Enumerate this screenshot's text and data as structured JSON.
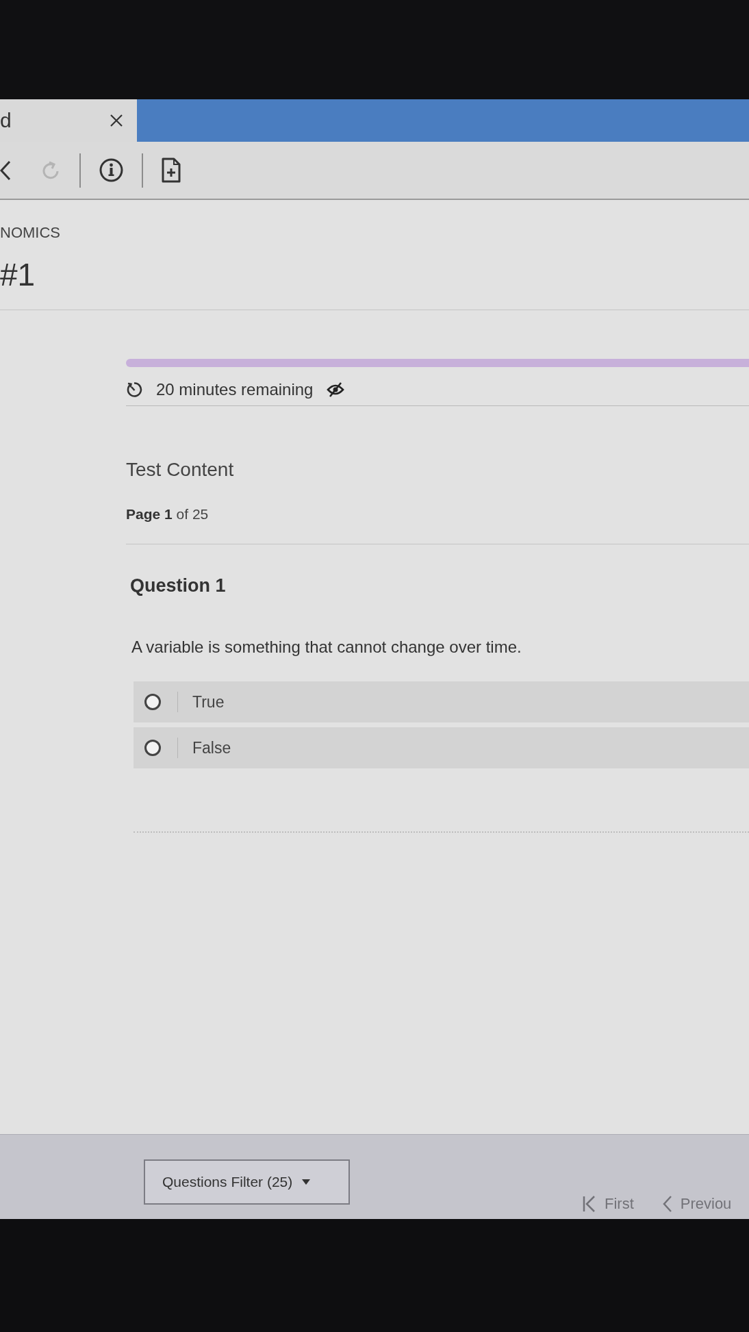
{
  "browser_tab": {
    "title": "d"
  },
  "toolbar": {
    "groups": [
      [
        {
          "kind": "back",
          "disabled": false
        },
        {
          "kind": "reload",
          "disabled": true
        }
      ],
      [
        {
          "kind": "info",
          "disabled": false
        }
      ],
      [
        {
          "kind": "add-page",
          "disabled": false
        }
      ]
    ]
  },
  "course": {
    "name": "NOMICS",
    "title": "#1"
  },
  "timer": {
    "text": "20 minutes remaining"
  },
  "section": {
    "title": "Test Content",
    "page": "**Page 1** of 25"
  },
  "question": {
    "title": "Question 1",
    "text": "A variable is something that cannot change over time.",
    "options": [
      {
        "label": "True",
        "selected": false
      },
      {
        "label": "False",
        "selected": false
      }
    ]
  },
  "footer": {
    "filter_button": "Questions Filter (25)",
    "nav": [
      {
        "kind": "first",
        "label": "First"
      },
      {
        "kind": "previous",
        "label": "Previou"
      }
    ]
  }
}
